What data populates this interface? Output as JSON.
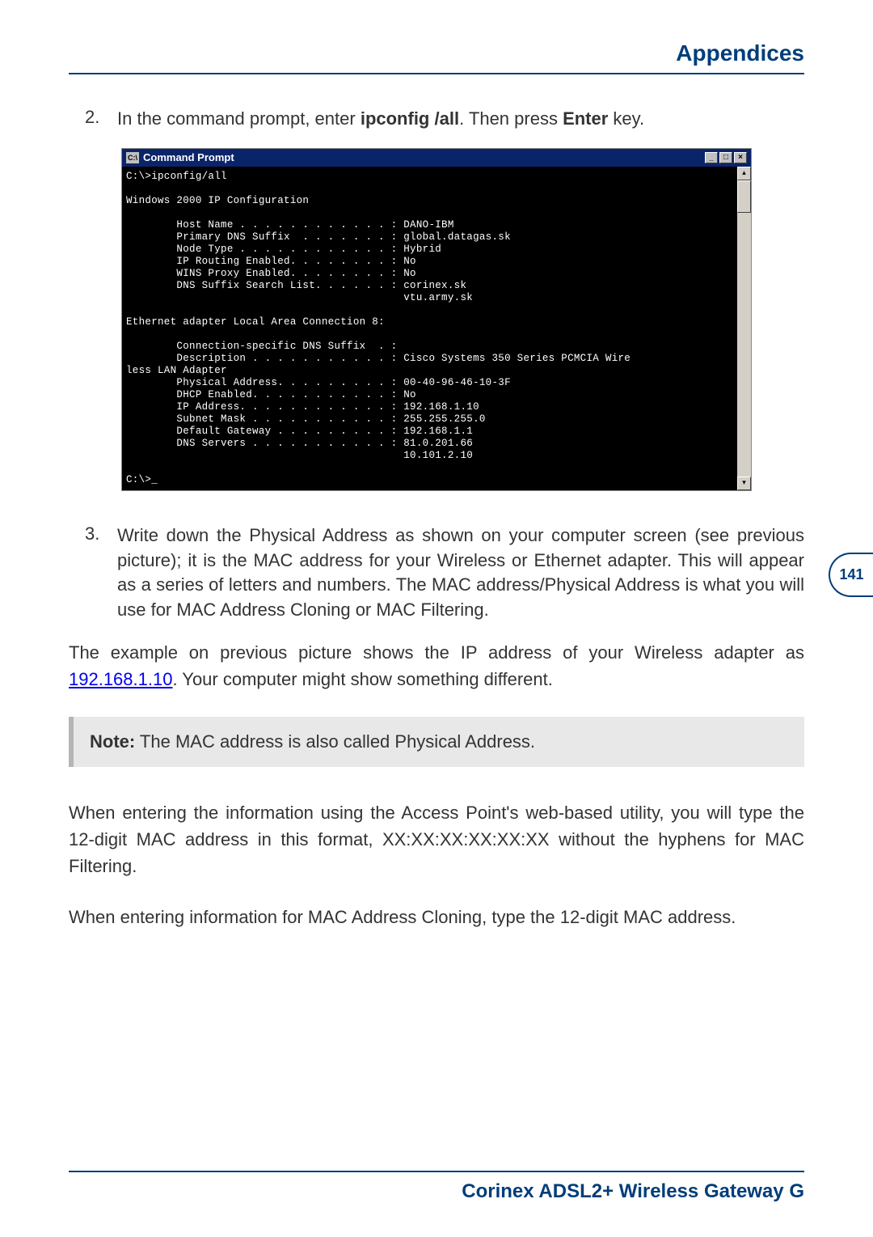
{
  "header": {
    "title": "Appendices"
  },
  "step2": {
    "number": "2.",
    "textPrefix": "In the command prompt, enter ",
    "cmd": "ipconfig /all",
    "textMid": ". Then press ",
    "enter": "Enter",
    "textSuffix": " key."
  },
  "terminal": {
    "title": "Command Prompt",
    "icon": "C:\\",
    "minBtn": "_",
    "maxBtn": "□",
    "closeBtn": "×",
    "scrollUp": "▴",
    "scrollDown": "▾",
    "lines": {
      "l1": "C:\\>ipconfig/all",
      "l2": "",
      "l3": "Windows 2000 IP Configuration",
      "l4": "",
      "l5": "        Host Name . . . . . . . . . . . . : DANO-IBM",
      "l6": "        Primary DNS Suffix  . . . . . . . : global.datagas.sk",
      "l7": "        Node Type . . . . . . . . . . . . : Hybrid",
      "l8": "        IP Routing Enabled. . . . . . . . : No",
      "l9": "        WINS Proxy Enabled. . . . . . . . : No",
      "l10": "        DNS Suffix Search List. . . . . . : corinex.sk",
      "l11": "                                            vtu.army.sk",
      "l12": "",
      "l13": "Ethernet adapter Local Area Connection 8:",
      "l14": "",
      "l15": "        Connection-specific DNS Suffix  . :",
      "l16": "        Description . . . . . . . . . . . : Cisco Systems 350 Series PCMCIA Wire",
      "l17": "less LAN Adapter",
      "l18": "        Physical Address. . . . . . . . . : 00-40-96-46-10-3F",
      "l19": "        DHCP Enabled. . . . . . . . . . . : No",
      "l20": "        IP Address. . . . . . . . . . . . : 192.168.1.10",
      "l21": "        Subnet Mask . . . . . . . . . . . : 255.255.255.0",
      "l22": "        Default Gateway . . . . . . . . . : 192.168.1.1",
      "l23": "        DNS Servers . . . . . . . . . . . : 81.0.201.66",
      "l24": "                                            10.101.2.10",
      "l25": "",
      "l26": "C:\\>_"
    }
  },
  "step3": {
    "number": "3.",
    "text": "Write down the Physical Address as shown on your computer screen (see previous picture); it is the MAC address for your Wireless or Ethernet adapter. This will appear as a series of letters and numbers. The MAC address/Physical Address is what you will use for MAC Address Cloning or MAC Filtering."
  },
  "para1": {
    "prefix": "The example on previous picture shows the IP address of your Wireless adapter as ",
    "ip": "192.168.1.10",
    "suffix": ". Your computer might show something different."
  },
  "note": {
    "label": "Note:",
    "text": " The MAC address is also called Physical Address."
  },
  "para2": "When entering the information using the Access Point's web-based utility, you will type the 12-digit MAC address in this format, XX:XX:XX:XX:XX:XX without the hyphens for MAC Filtering.",
  "para3": "When entering information for MAC Address Cloning, type the 12-digit MAC address.",
  "pageNumber": "141",
  "footer": "Corinex ADSL2+ Wireless Gateway G"
}
